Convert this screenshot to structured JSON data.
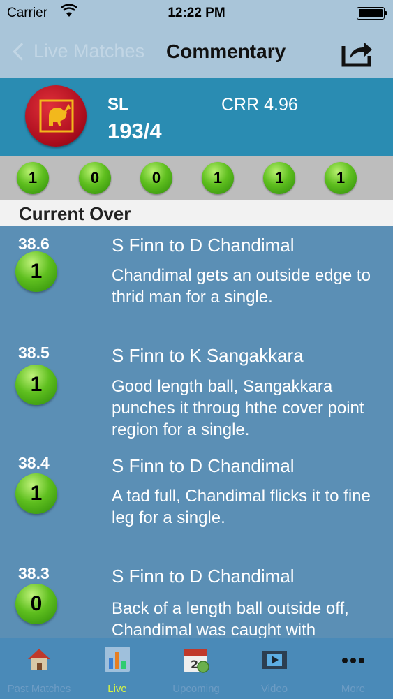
{
  "status_bar": {
    "carrier": "Carrier",
    "time": "12:22 PM"
  },
  "nav": {
    "back_label": "Live Matches",
    "title": "Commentary"
  },
  "score_panel": {
    "team": "SL",
    "score": "193/4",
    "crr": "CRR 4.96"
  },
  "recent_balls": [
    "1",
    "0",
    "0",
    "1",
    "1",
    "1"
  ],
  "section": {
    "title": "Current Over"
  },
  "commentary": [
    {
      "over": "38.6",
      "runs": "1",
      "bowler": "S Finn to D Chandimal",
      "text": "Chandimal gets an outside edge to thrid man for a single."
    },
    {
      "over": "38.5",
      "runs": "1",
      "bowler": "S Finn to K Sangakkara",
      "text": "Good length ball, Sangakkara punches it throug hthe cover point region for a single."
    },
    {
      "over": "38.4",
      "runs": "1",
      "bowler": "S Finn to D Chandimal",
      "text": "A tad full, Chandimal flicks it to fine leg for a single."
    },
    {
      "over": "38.3",
      "runs": "0",
      "bowler": "S Finn to D Chandimal",
      "text": "Back of a length ball outside off, Chandimal was caught with"
    }
  ],
  "tabs": [
    {
      "label": "Past Matches",
      "icon": "house-icon"
    },
    {
      "label": "Live",
      "icon": "live-chart-icon"
    },
    {
      "label": "Upcoming",
      "icon": "calendar-icon"
    },
    {
      "label": "Video",
      "icon": "film-icon"
    },
    {
      "label": "More",
      "icon": "more-icon"
    }
  ],
  "colors": {
    "accent_active_tab": "#d8f542",
    "score_panel": "#2a8cb2",
    "ball_green": "#5fbf1f"
  }
}
